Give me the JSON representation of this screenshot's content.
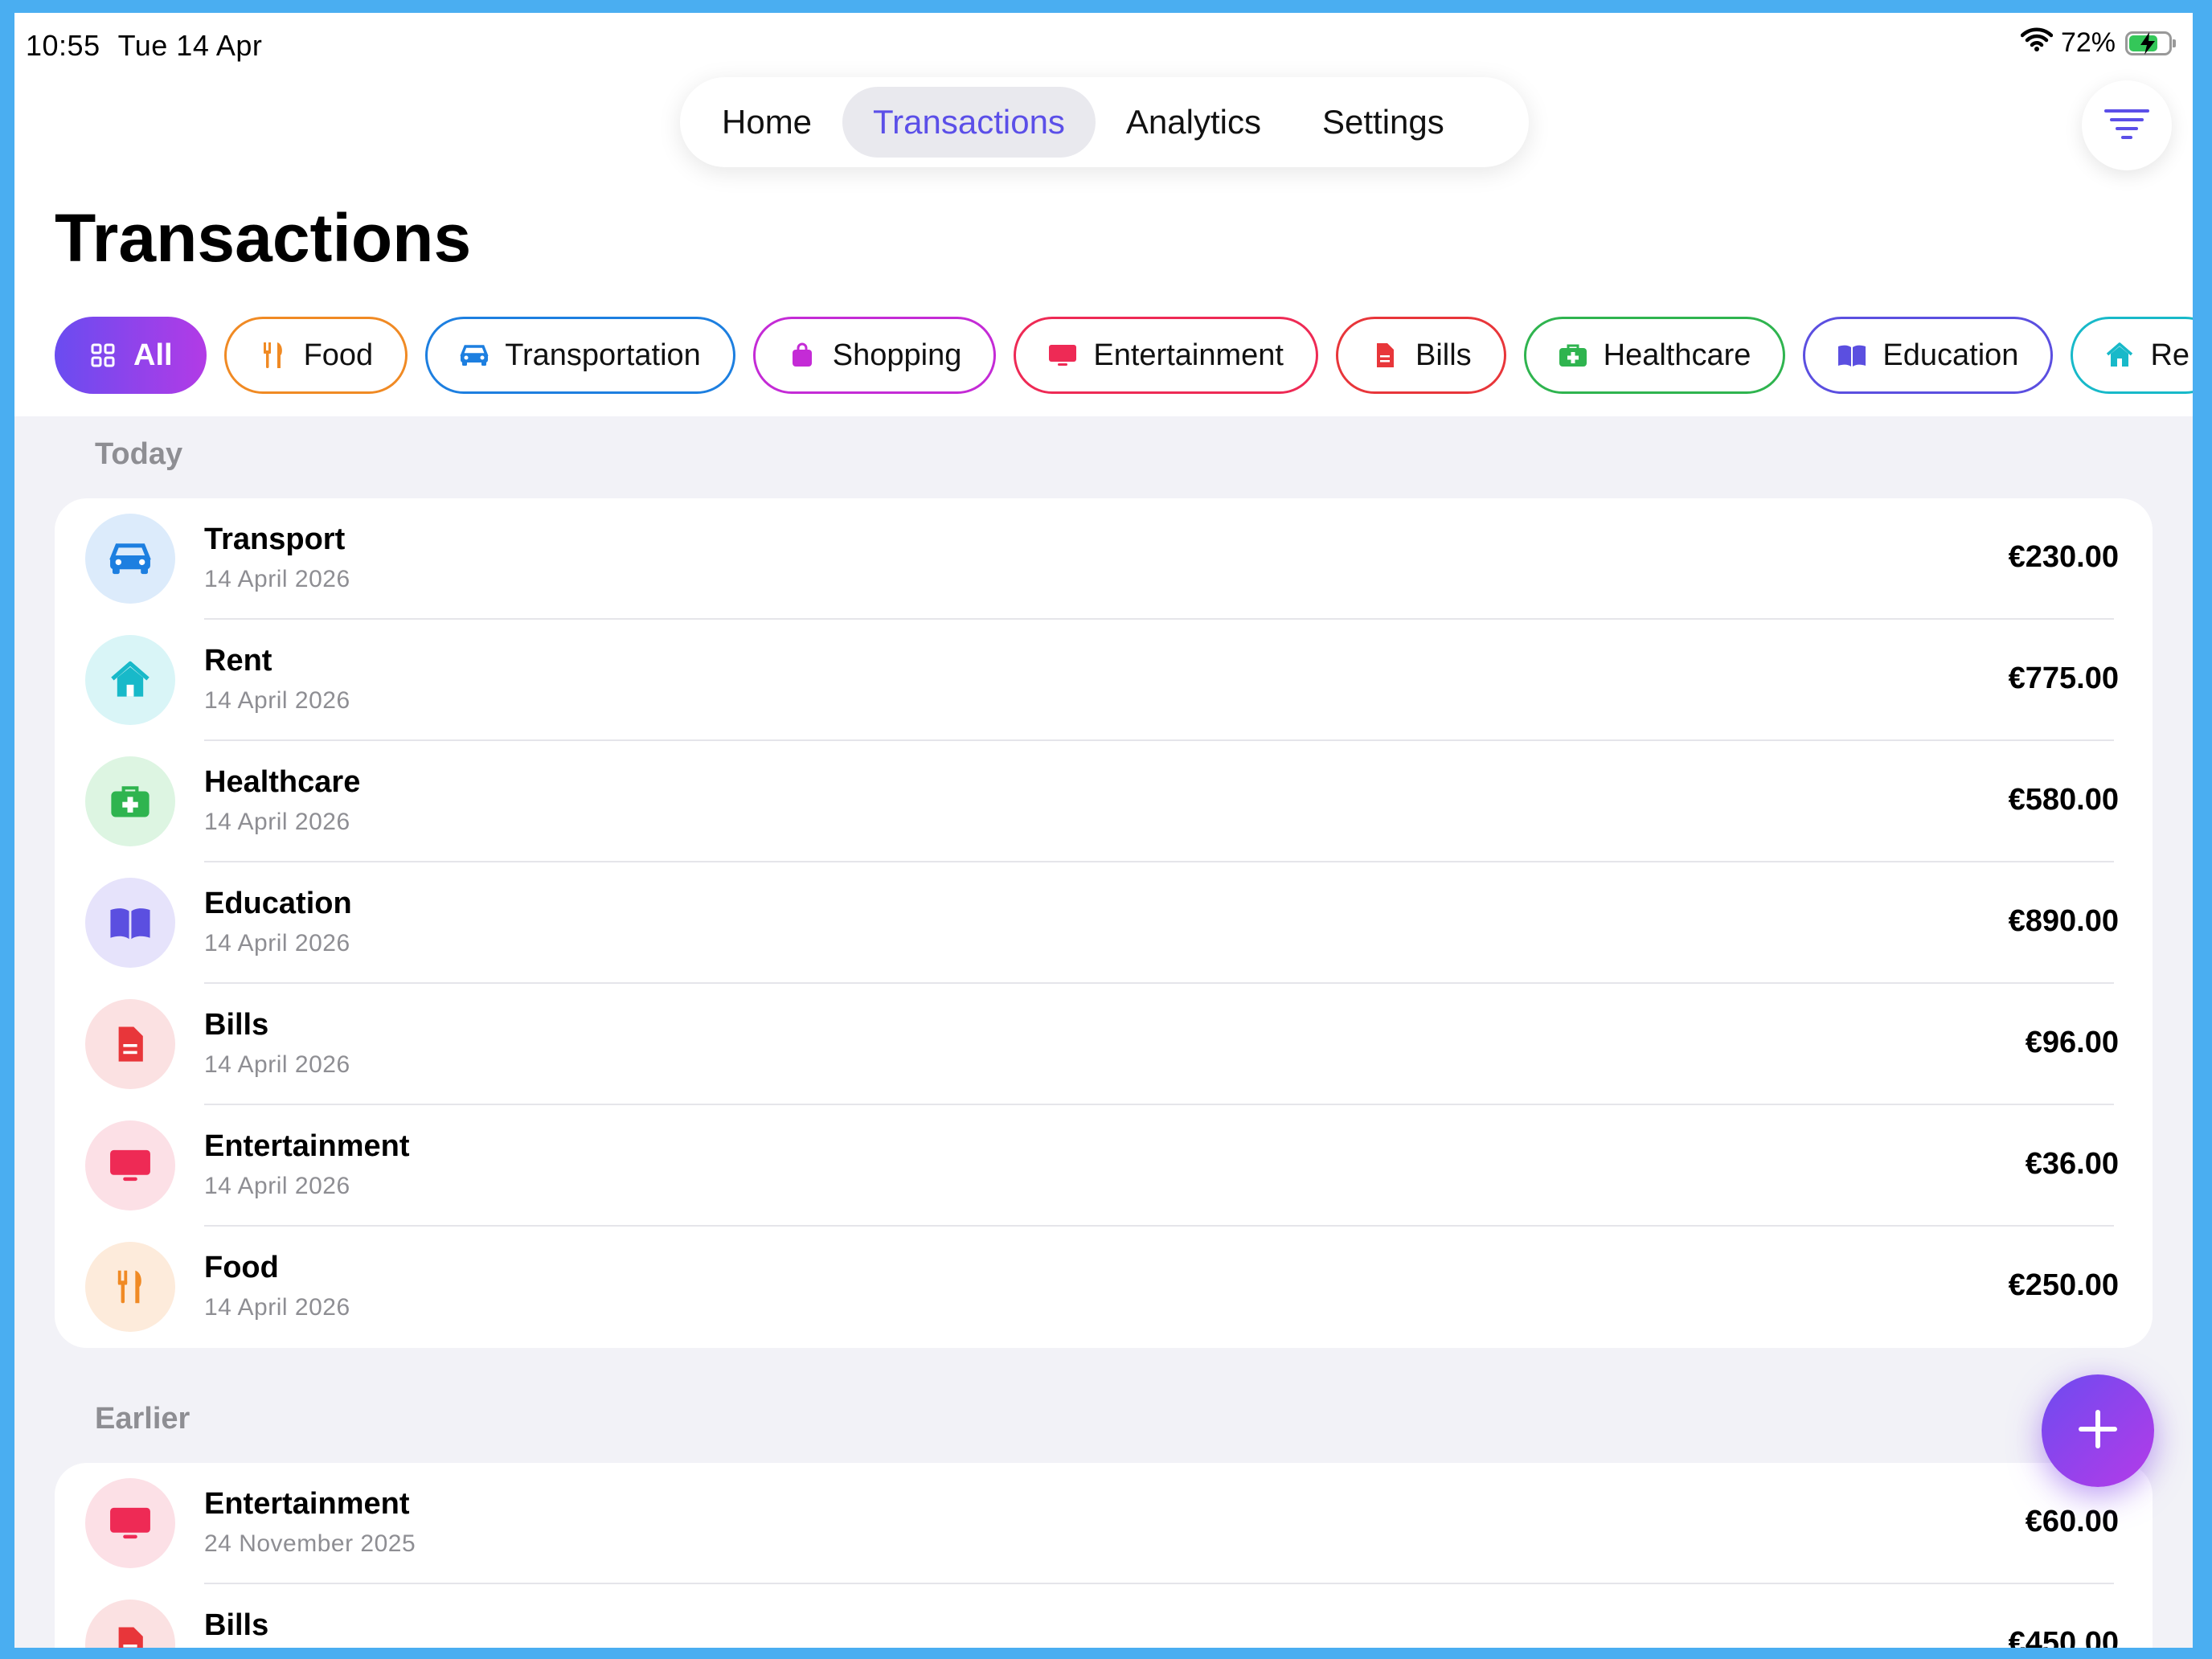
{
  "status_bar": {
    "time": "10:55",
    "date": "Tue 14 Apr",
    "battery_pct": "72%",
    "battery_level": 0.72,
    "icons": [
      "wifi-icon",
      "battery-charging-icon"
    ]
  },
  "nav": {
    "tabs": [
      {
        "label": "Home"
      },
      {
        "label": "Transactions",
        "active": true
      },
      {
        "label": "Analytics"
      },
      {
        "label": "Settings"
      }
    ],
    "filter_icon": "filter-lines-icon"
  },
  "page": {
    "title": "Transactions"
  },
  "categories": [
    {
      "label": "All",
      "icon": "grid-icon",
      "color": "#7B46EE",
      "selected": true
    },
    {
      "label": "Food",
      "icon": "fork-knife-icon",
      "color": "#F08A24"
    },
    {
      "label": "Transportation",
      "icon": "car-icon",
      "color": "#1D7FE0"
    },
    {
      "label": "Shopping",
      "icon": "shopping-bag-icon",
      "color": "#C42BD6"
    },
    {
      "label": "Entertainment",
      "icon": "tv-icon",
      "color": "#EE2A55"
    },
    {
      "label": "Bills",
      "icon": "document-icon",
      "color": "#E8363A"
    },
    {
      "label": "Healthcare",
      "icon": "medical-kit-icon",
      "color": "#2FB44F"
    },
    {
      "label": "Education",
      "icon": "book-icon",
      "color": "#5B4FE0"
    },
    {
      "label": "Re",
      "icon": "house-icon",
      "color": "#18B9C9"
    }
  ],
  "sections": {
    "today": {
      "label": "Today",
      "transactions": [
        {
          "name": "Transport",
          "date": "14 April 2026",
          "amount": "€230.00",
          "icon": "car-icon",
          "color": "#1D7FE0"
        },
        {
          "name": "Rent",
          "date": "14 April 2026",
          "amount": "€775.00",
          "icon": "house-icon",
          "color": "#18B9C9"
        },
        {
          "name": "Healthcare",
          "date": "14 April 2026",
          "amount": "€580.00",
          "icon": "medical-kit-icon",
          "color": "#2FB44F"
        },
        {
          "name": "Education",
          "date": "14 April 2026",
          "amount": "€890.00",
          "icon": "book-icon",
          "color": "#5B4FE0"
        },
        {
          "name": "Bills",
          "date": "14 April 2026",
          "amount": "€96.00",
          "icon": "document-icon",
          "color": "#E8363A"
        },
        {
          "name": "Entertainment",
          "date": "14 April 2026",
          "amount": "€36.00",
          "icon": "tv-icon",
          "color": "#EE2A55"
        },
        {
          "name": "Food",
          "date": "14 April 2026",
          "amount": "€250.00",
          "icon": "fork-knife-icon",
          "color": "#F08A24"
        }
      ]
    },
    "earlier": {
      "label": "Earlier",
      "transactions": [
        {
          "name": "Entertainment",
          "date": "24 November 2025",
          "amount": "€60.00",
          "icon": "tv-icon",
          "color": "#EE2A55"
        },
        {
          "name": "Bills",
          "date": "",
          "amount": "€450.00",
          "icon": "document-icon",
          "color": "#E8363A"
        }
      ]
    }
  },
  "fab": {
    "icon": "plus-icon"
  }
}
